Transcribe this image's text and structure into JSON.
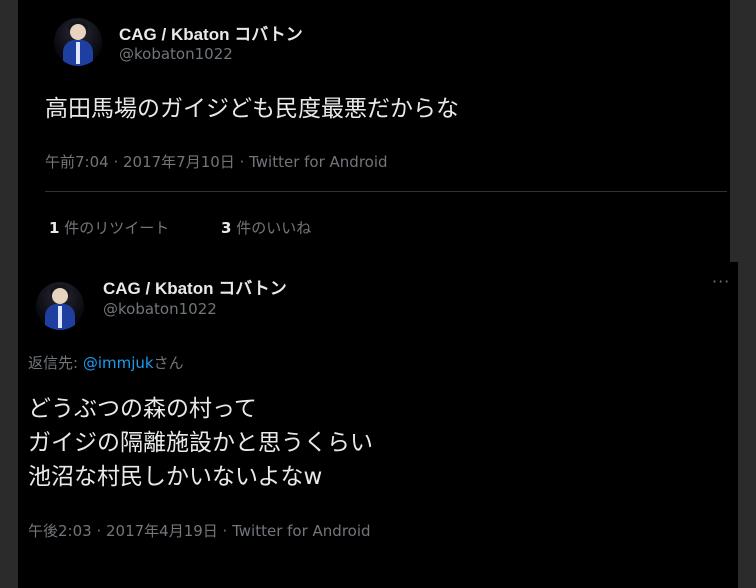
{
  "tweet1": {
    "display_name": "CAG / Kbaton コバトン",
    "handle": "@kobaton1022",
    "text": "高田馬場のガイジども民度最悪だからな",
    "meta": "午前7:04 · 2017年7月10日 · Twitter for Android",
    "retweets": {
      "count": "1",
      "label": "件のリツイート"
    },
    "likes": {
      "count": "3",
      "label": "件のいいね"
    }
  },
  "tweet2": {
    "display_name": "CAG / Kbaton コバトン",
    "handle": "@kobaton1022",
    "more_label": "···",
    "reply_prefix": "返信先: ",
    "reply_user": "@immjuk",
    "reply_suffix": "さん",
    "text_lines": [
      "どうぶつの森の村って",
      "ガイジの隔離施設かと思うくらい",
      "池沼な村民しかいないよなw"
    ],
    "meta": "午後2:03 · 2017年4月19日 · Twitter for Android"
  },
  "colors": {
    "background": "#000000",
    "outer_frame": "#2b2b2b",
    "primary_text": "#e7e9ea",
    "secondary_text": "#71767b",
    "link": "#1d9bf0"
  }
}
